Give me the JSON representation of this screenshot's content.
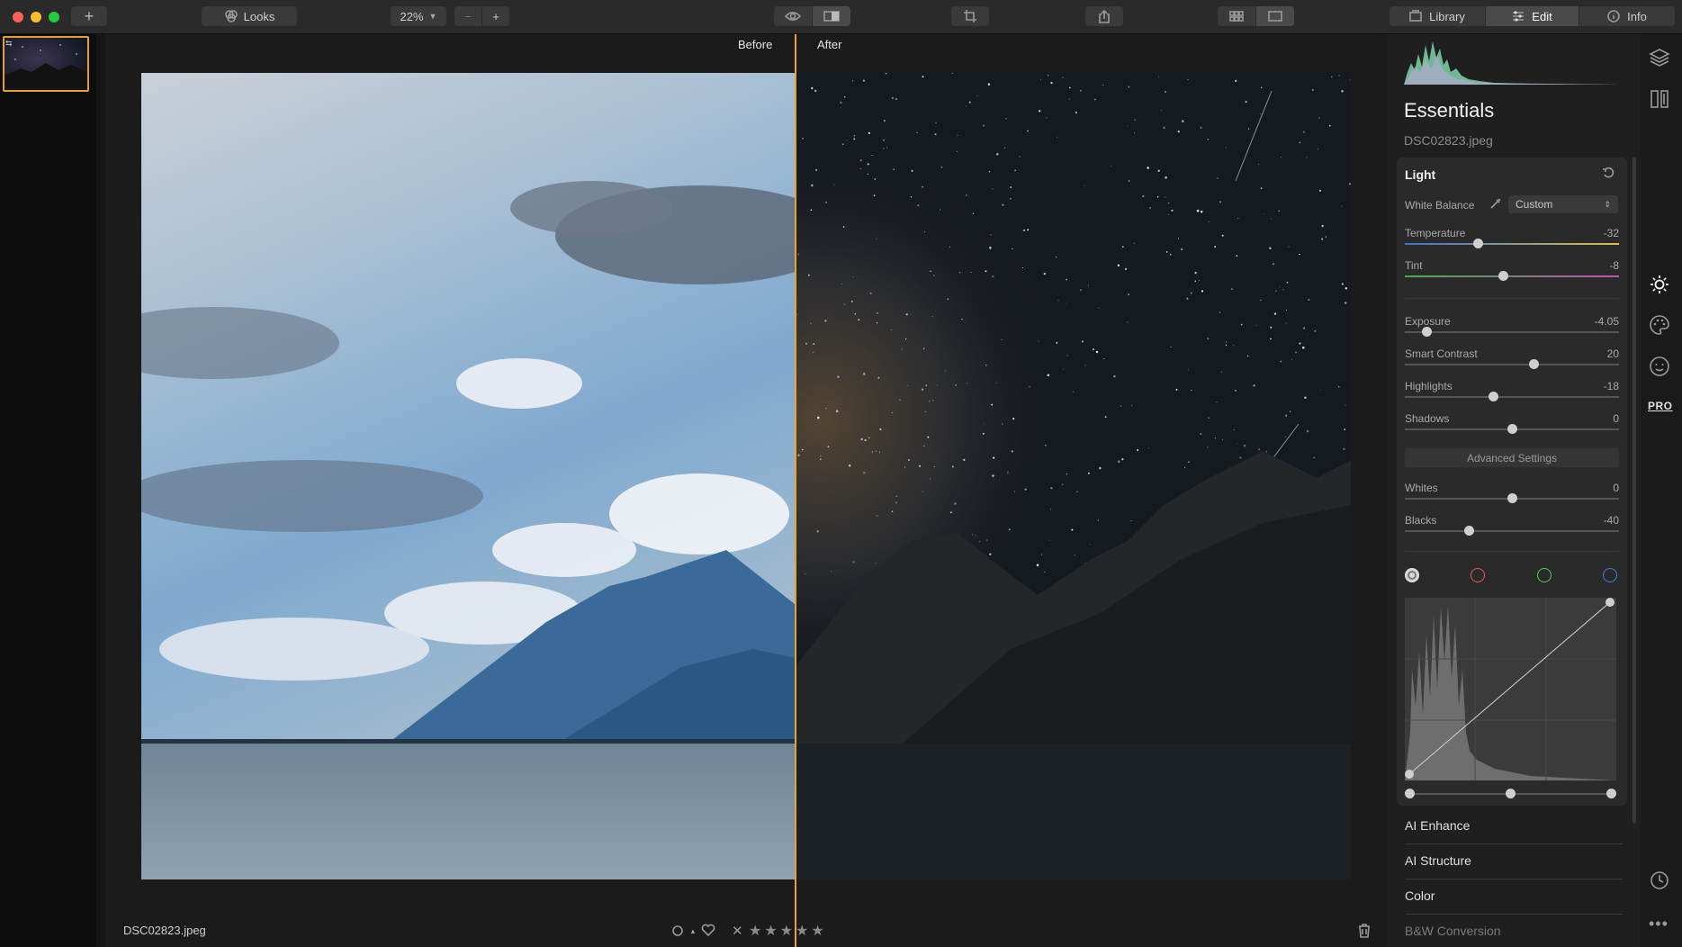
{
  "toolbar": {
    "looks_label": "Looks",
    "zoom_value": "22%",
    "library_label": "Library",
    "edit_label": "Edit",
    "info_label": "Info"
  },
  "viewer": {
    "before_label": "Before",
    "after_label": "After",
    "split_position_percent": 54
  },
  "footer": {
    "filename": "DSC02823.jpeg",
    "rating": 0,
    "max_rating": 5
  },
  "panel": {
    "title": "Essentials",
    "filename": "DSC02823.jpeg",
    "light": {
      "title": "Light",
      "white_balance_label": "White Balance",
      "white_balance_value": "Custom",
      "sliders_a": [
        {
          "label": "Temperature",
          "value": "-32",
          "level": 0.34
        },
        {
          "label": "Tint",
          "value": "-8",
          "level": 0.46
        }
      ],
      "sliders_b": [
        {
          "label": "Exposure",
          "value": "-4.05",
          "level": 0.1
        },
        {
          "label": "Smart Contrast",
          "value": "20",
          "level": 0.6
        },
        {
          "label": "Highlights",
          "value": "-18",
          "level": 0.41
        },
        {
          "label": "Shadows",
          "value": "0",
          "level": 0.5
        }
      ],
      "advanced_label": "Advanced Settings",
      "sliders_c": [
        {
          "label": "Whites",
          "value": "0",
          "level": 0.5
        },
        {
          "label": "Blacks",
          "value": "-40",
          "level": 0.3
        }
      ],
      "curve_channels": [
        "luminance",
        "red",
        "green",
        "blue"
      ]
    },
    "sections": [
      "AI Enhance",
      "AI Structure",
      "Color",
      "B&W Conversion"
    ]
  },
  "side_icons": [
    "layers-icon",
    "presets-icon",
    "sun-icon",
    "palette-icon",
    "face-icon",
    "pro-icon",
    "history-icon",
    "more-icon"
  ],
  "pro_label": "PRO",
  "colors": {
    "accent": "#e6a33a",
    "panel_bg": "#1f1f1f",
    "card_bg": "#2a2a2a"
  }
}
